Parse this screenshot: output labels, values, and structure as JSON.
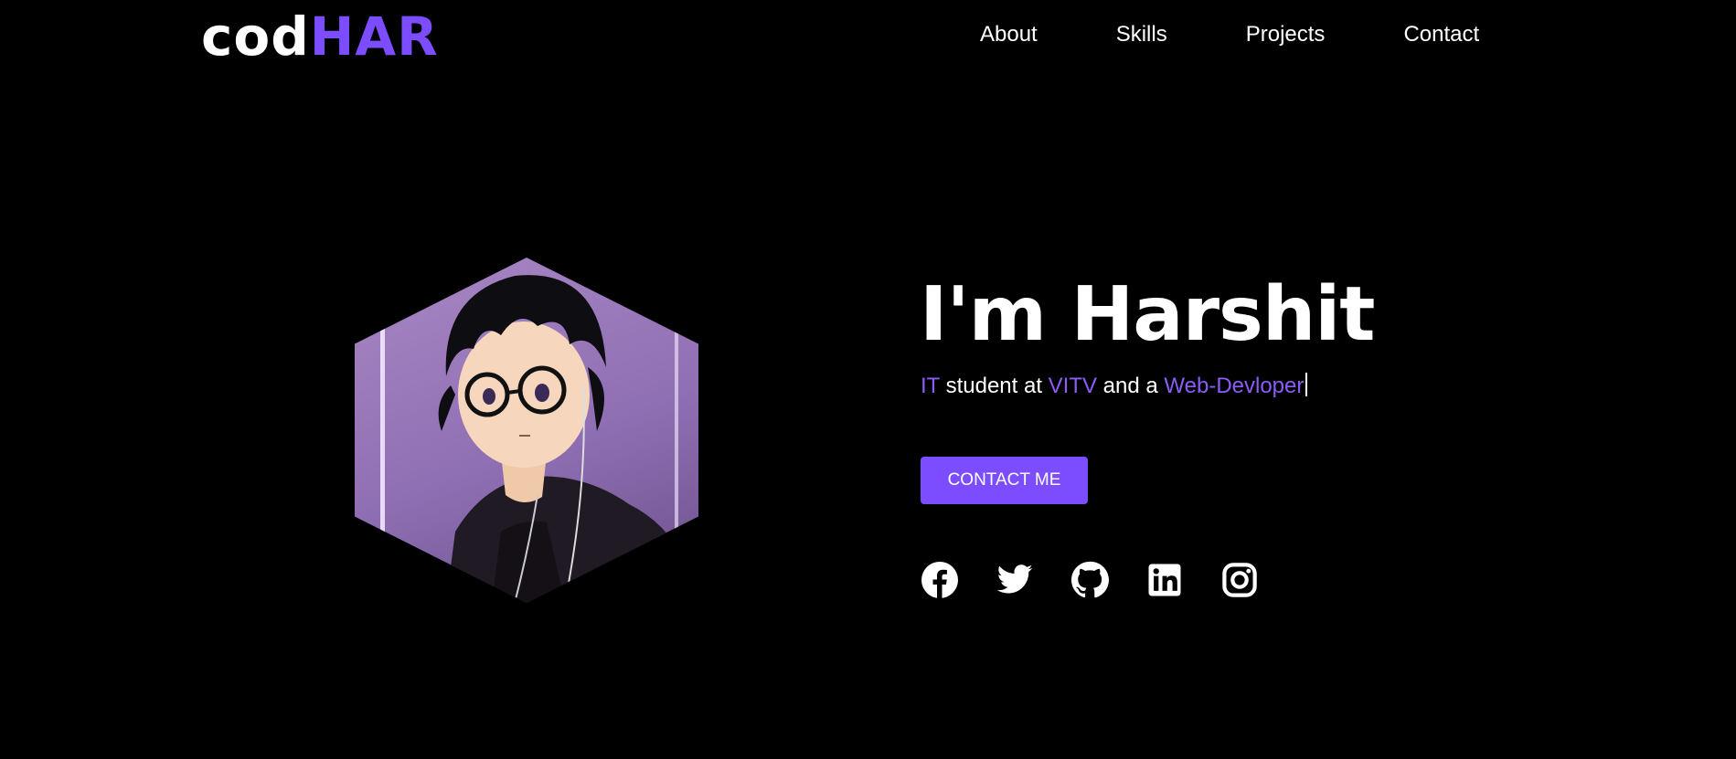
{
  "logo": {
    "part1": "cod",
    "part2": "HAR"
  },
  "nav": {
    "items": [
      "About",
      "Skills",
      "Projects",
      "Contact"
    ]
  },
  "hero": {
    "title": "I'm Harshit",
    "subtitle": {
      "p1": "IT",
      "p2": " student at ",
      "p3": "VITV",
      "p4": " and a ",
      "p5": "Web-Devloper"
    },
    "cta": "CONTACT ME"
  },
  "socials": [
    "facebook-icon",
    "twitter-icon",
    "github-icon",
    "linkedin-icon",
    "instagram-icon"
  ],
  "colors": {
    "accent": "#7c4dff",
    "background": "#000000",
    "text": "#ffffff"
  }
}
